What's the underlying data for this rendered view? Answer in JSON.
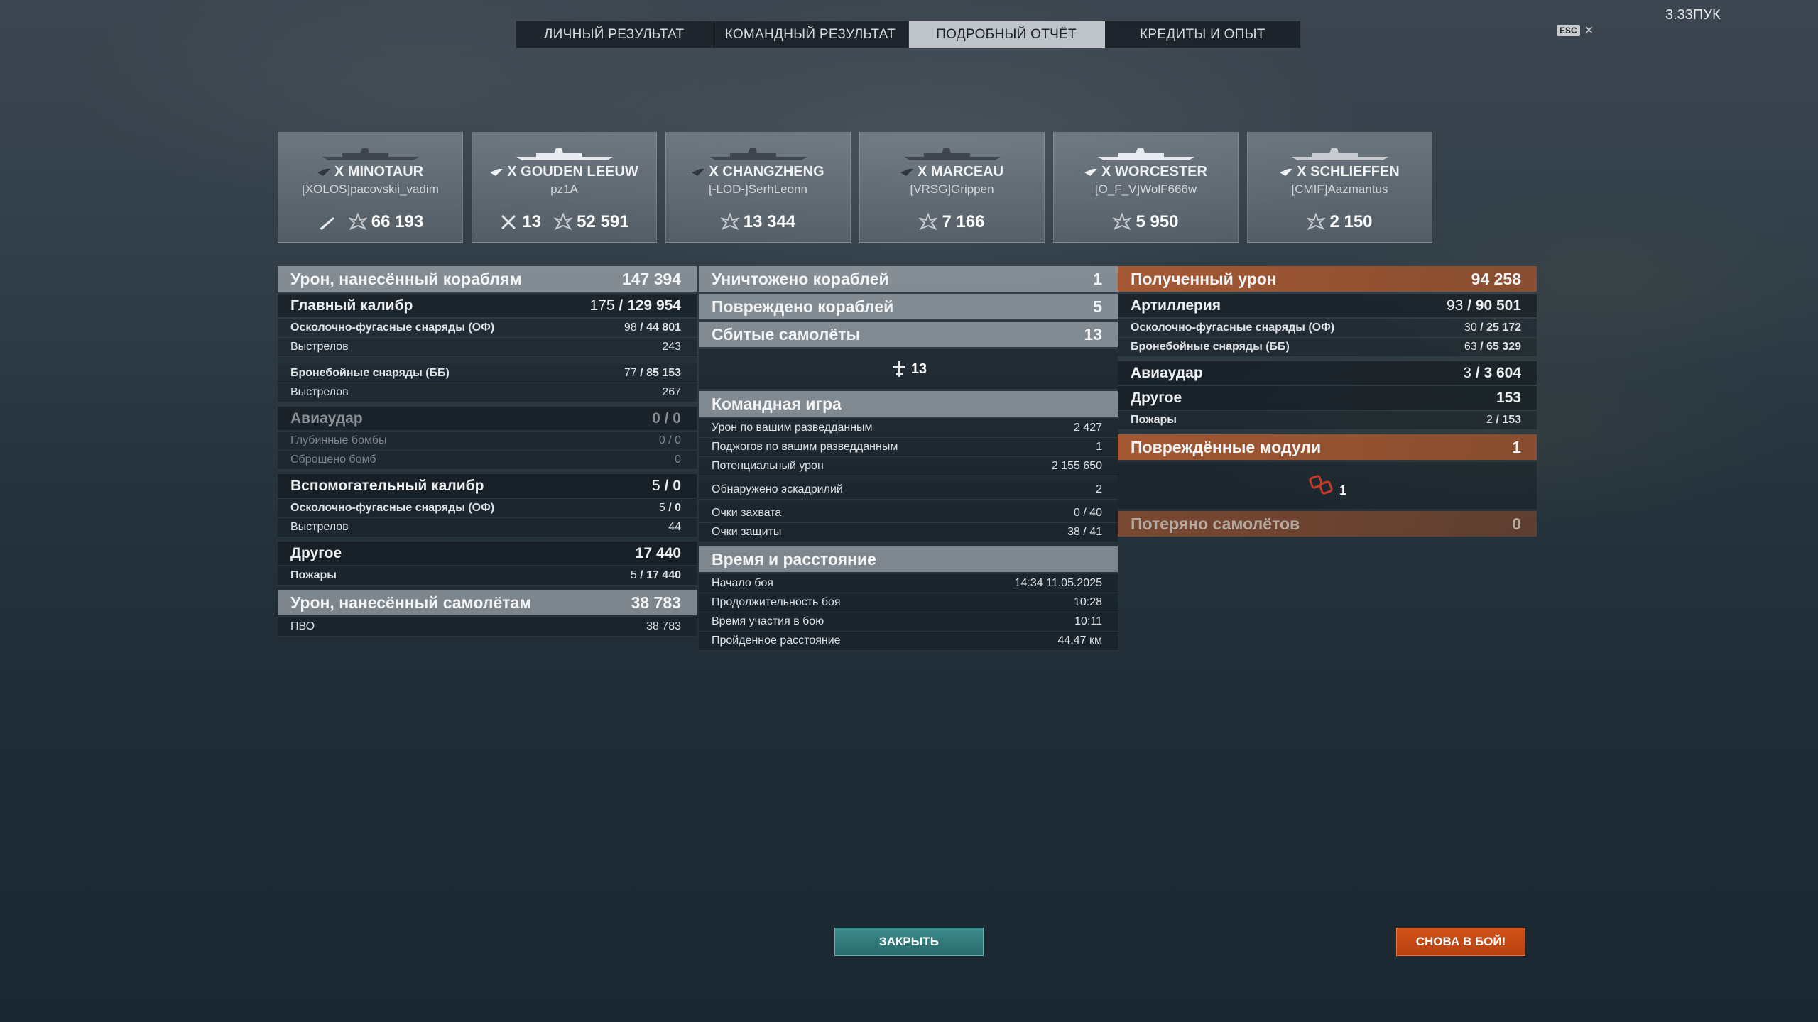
{
  "tabs": [
    {
      "label": "ЛИЧНЫЙ РЕЗУЛЬТАТ",
      "active": false
    },
    {
      "label": "КОМАНДНЫЙ РЕЗУЛЬТАТ",
      "active": false
    },
    {
      "label": "ПОДРОБНЫЙ ОТЧЁТ",
      "active": true
    },
    {
      "label": "КРЕДИТЫ И ОПЫТ",
      "active": false
    }
  ],
  "esc_label": "ESC",
  "player_name": "3.33ПУК",
  "ships": [
    {
      "name": "X MINOTAUR",
      "player": "[XOLOS]pacovskii_vadim",
      "icon1": "ship-icon",
      "stat1": "",
      "stat2": "66 193"
    },
    {
      "name": "X GOUDEN LEEUW",
      "player": "pz1A",
      "icon1": "planes-shot-icon",
      "stat1": "13",
      "stat2": "52 591"
    },
    {
      "name": "X CHANGZHENG",
      "player": "[-LOD-]SerhLeonn",
      "icon1": "",
      "stat1": "",
      "stat2": "13 344"
    },
    {
      "name": "X MARCEAU",
      "player": "[VRSG]Grippen",
      "icon1": "",
      "stat1": "",
      "stat2": "7 166"
    },
    {
      "name": "X WORCESTER",
      "player": "[O_F_V]WolF666w",
      "icon1": "",
      "stat1": "",
      "stat2": "5 950"
    },
    {
      "name": "X SCHLIEFFEN",
      "player": "[CMIF]Aazmantus",
      "icon1": "",
      "stat1": "",
      "stat2": "2 150"
    }
  ],
  "left": {
    "dmg_ships": {
      "label": "Урон, нанесённый кораблям",
      "value": "147 394"
    },
    "main_cal": {
      "label": "Главный калибр",
      "hits": "175",
      "total": "129 954"
    },
    "he": {
      "label": "Осколочно-фугасные снаряды (ОФ)",
      "hits": "98",
      "dmg": "44 801"
    },
    "he_shots": {
      "label": "Выстрелов",
      "value": "243"
    },
    "ap": {
      "label": "Бронебойные снаряды (ББ)",
      "hits": "77",
      "dmg": "85 153"
    },
    "ap_shots": {
      "label": "Выстрелов",
      "value": "267"
    },
    "air": {
      "label": "Авиаудар",
      "value": "0 / 0"
    },
    "depth": {
      "label": "Глубинные бомбы",
      "value": "0 / 0"
    },
    "bombs": {
      "label": "Сброшено бомб",
      "value": "0"
    },
    "sec": {
      "label": "Вспомогательный калибр",
      "hits": "5",
      "total": "0"
    },
    "sec_he": {
      "label": "Осколочно-фугасные снаряды (ОФ)",
      "hits": "5",
      "dmg": "0"
    },
    "sec_shots": {
      "label": "Выстрелов",
      "value": "44"
    },
    "other": {
      "label": "Другое",
      "value": "17 440"
    },
    "fires": {
      "label": "Пожары",
      "hits": "5",
      "dmg": "17 440"
    },
    "dmg_planes": {
      "label": "Урон, нанесённый самолётам",
      "value": "38 783"
    },
    "aa": {
      "label": "ПВО",
      "value": "38 783"
    }
  },
  "mid": {
    "destroyed": {
      "label": "Уничтожено кораблей",
      "value": "1"
    },
    "damaged": {
      "label": "Повреждено кораблей",
      "value": "5"
    },
    "planes": {
      "label": "Сбитые самолёты",
      "value": "13"
    },
    "planes_icon_count": "13",
    "team": {
      "label": "Командная игра"
    },
    "team_rows": [
      {
        "label": "Урон по вашим разведданным",
        "value": "2 427"
      },
      {
        "label": "Поджогов по вашим разведданным",
        "value": "1"
      },
      {
        "label": "Потенциальный урон",
        "value": "2 155 650"
      },
      {
        "label": "Обнаружено эскадрилий",
        "value": "2"
      },
      {
        "label": "Очки захвата",
        "value": "0 / 40"
      },
      {
        "label": "Очки защиты",
        "value": "38 / 41"
      }
    ],
    "time": {
      "label": "Время и расстояние"
    },
    "time_rows": [
      {
        "label": "Начало боя",
        "value": "14:34  11.05.2025"
      },
      {
        "label": "Продолжительность боя",
        "value": "10:28"
      },
      {
        "label": "Время участия в бою",
        "value": "10:11"
      },
      {
        "label": "Пройденное расстояние",
        "value": "44.47 км"
      }
    ]
  },
  "right": {
    "received": {
      "label": "Полученный урон",
      "value": "94 258"
    },
    "artillery": {
      "label": "Артиллерия",
      "hits": "93",
      "total": "90 501"
    },
    "he": {
      "label": "Осколочно-фугасные снаряды (ОФ)",
      "hits": "30",
      "dmg": "25 172"
    },
    "ap": {
      "label": "Бронебойные снаряды (ББ)",
      "hits": "63",
      "dmg": "65 329"
    },
    "air": {
      "label": "Авиаудар",
      "hits": "3",
      "total": "3 604"
    },
    "other": {
      "label": "Другое",
      "value": "153"
    },
    "fires": {
      "label": "Пожары",
      "hits": "2",
      "dmg": "153"
    },
    "modules": {
      "label": "Повреждённые модули",
      "value": "1"
    },
    "modules_icon_count": "1",
    "lost_planes": {
      "label": "Потеряно самолётов",
      "value": "0"
    }
  },
  "buttons": {
    "close": "ЗАКРЫТЬ",
    "again": "СНОВА В БОЙ!"
  },
  "colors": {
    "accent_orange": "#c0552a",
    "close_teal": "#2f7d7e",
    "again_orange": "#c8491a"
  }
}
